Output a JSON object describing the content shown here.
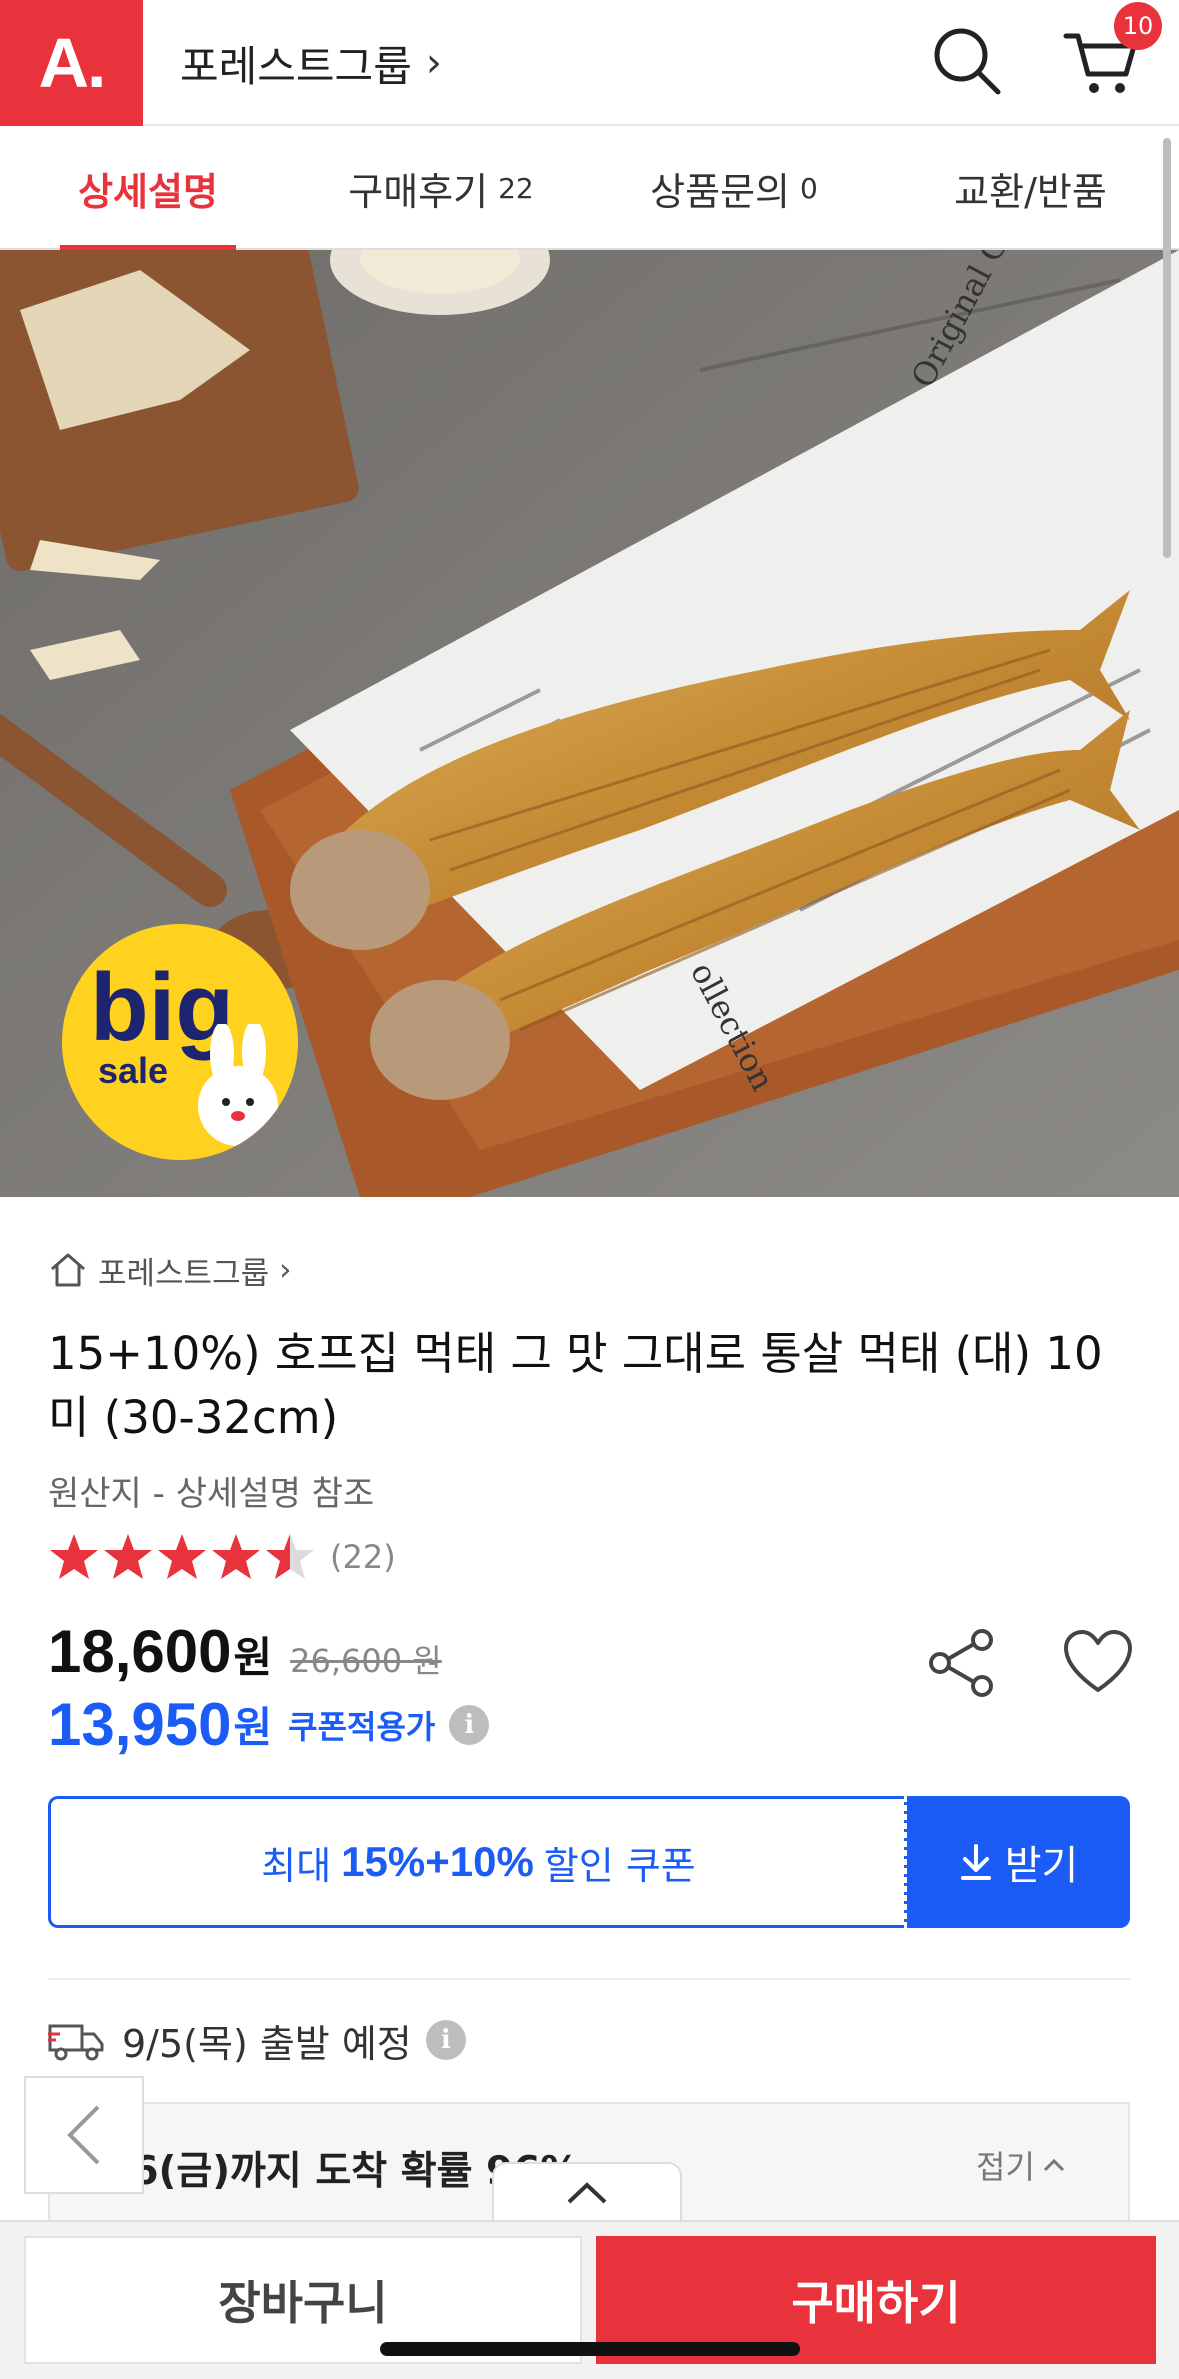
{
  "header": {
    "logo": "A.",
    "store_name": "포레스트그룹",
    "cart_count": "10"
  },
  "tabs": [
    {
      "label": "상세설명",
      "count": ""
    },
    {
      "label": "구매후기",
      "count": "22"
    },
    {
      "label": "상품문의",
      "count": "0"
    },
    {
      "label": "교환/반품",
      "count": ""
    }
  ],
  "badge": {
    "line1": "big",
    "line2": "sale"
  },
  "product": {
    "brand": "포레스트그룹",
    "title": "15+10%) 호프집 먹태 그 맛 그대로 통살 먹태 (대) 10미 (30-32cm)",
    "origin": "원산지 - 상세설명 참조",
    "rating": 4.5,
    "review_count": "(22)",
    "price": "18,600",
    "price_unit": "원",
    "original_price": "26,600 원",
    "coupon_price": "13,950",
    "coupon_unit": "원",
    "coupon_price_label": "쿠폰적용가"
  },
  "coupon": {
    "prefix": "최대",
    "rate": "15%+10%",
    "suffix": "할인 쿠폰",
    "button": "받기"
  },
  "delivery": {
    "schedule": "9/5(목) 출발 예정",
    "arrival": "9/6(금)까지 도착 확률 96%",
    "collapse": "접기"
  },
  "actions": {
    "cart": "장바구니",
    "buy": "구매하기"
  },
  "colors": {
    "brand_red": "#e8323c",
    "coupon_blue": "#1a5cf5"
  }
}
